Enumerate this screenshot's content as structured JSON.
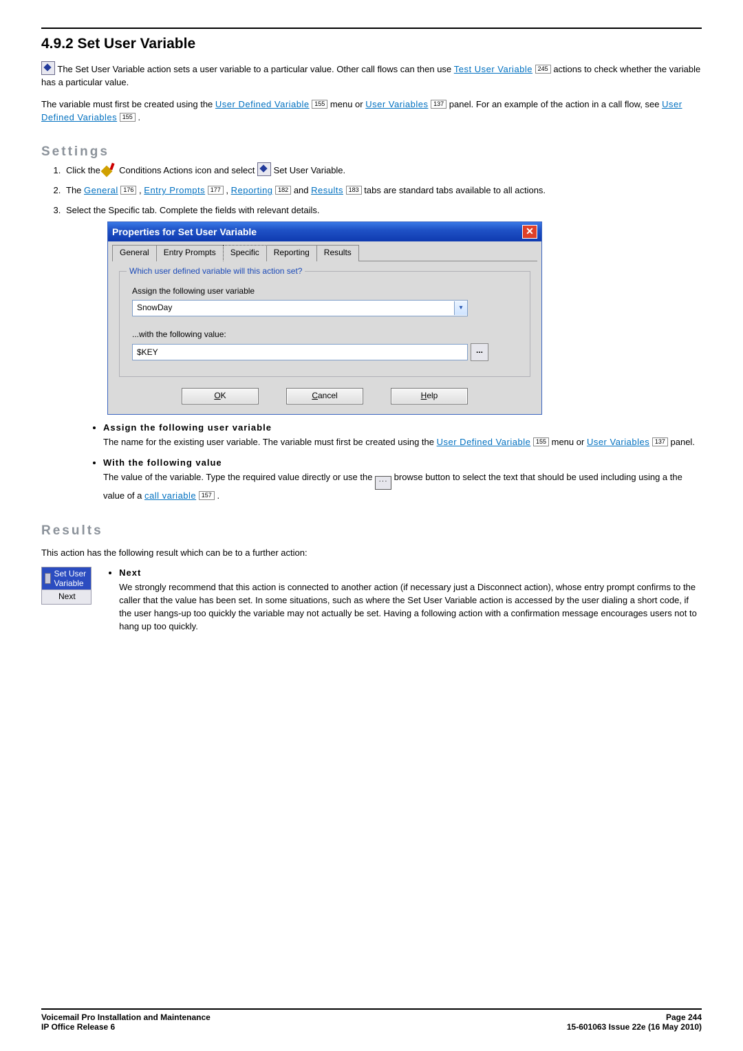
{
  "heading": "4.9.2 Set User Variable",
  "intro": {
    "line1_a": " The Set User Variable action sets a user variable to a particular value. Other call flows can then use ",
    "link_test_user_variable": "Test User Variable",
    "ref_245": "245",
    "line1_b": " actions to check whether the variable has a particular value.",
    "line2_a": "The variable must first be created using the ",
    "link_udv": "User Defined Variable",
    "ref_155": "155",
    "line2_b": " menu or ",
    "link_uv": "User Variables",
    "ref_137": "137",
    "line2_c": " panel. For an example of the action in a call flow, see ",
    "link_udvars2": "User Defined Variables",
    "line2_d": "."
  },
  "settings": {
    "title": "Settings",
    "step1_a": "Click the ",
    "step1_b": " Conditions Actions icon and select ",
    "step1_c": " Set User Variable.",
    "step2_a": "The ",
    "link_general": "General",
    "ref_176": "176",
    "sep": ", ",
    "link_entry": "Entry Prompts",
    "ref_177": "177",
    "link_reporting": "Reporting",
    "ref_182": "182",
    "and": " and ",
    "link_results": "Results",
    "ref_183": "183",
    "step2_b": " tabs are standard tabs available to all actions.",
    "step3": "Select the Specific tab. Complete the fields with relevant details."
  },
  "dialog": {
    "title": "Properties for Set User Variable",
    "tabs": {
      "general": "General",
      "entry": "Entry Prompts",
      "specific": "Specific",
      "reporting": "Reporting",
      "results": "Results"
    },
    "legend": "Which user defined variable will this action set?",
    "label1": "Assign the following user variable",
    "combo_value": "SnowDay",
    "label2": "...with the following value:",
    "text_value": "$KEY",
    "browse": "...",
    "ok": "OK",
    "ok_ul": "O",
    "cancel": "Cancel",
    "cancel_ul": "C",
    "help": "Help",
    "help_ul": "H"
  },
  "opts": {
    "opt1_title": "Assign the following user variable",
    "opt1_body_a": "The name for the existing user variable. The variable must first be created using the ",
    "opt1_link1": "User Defined Variable",
    "opt1_ref155": "155",
    "opt1_body_b": " menu or ",
    "opt1_link2": "User Variables",
    "opt1_ref137": "137",
    "opt1_body_c": " panel.",
    "opt2_title": "With the following value",
    "opt2_body_a": "The value of the variable. Type the required value directly or use the ",
    "opt2_body_b": " browse button to select the text that should be used including using a the value of a ",
    "opt2_link": "call variable",
    "opt2_ref157": "157",
    "opt2_body_c": "."
  },
  "results": {
    "title": "Results",
    "intro": "This action has the following result which can be to a further action:",
    "node_title": "Set User Variable",
    "node_row": "Next",
    "next_title": "Next",
    "next_body": "We strongly recommend that this action is connected to another action (if necessary just a Disconnect action), whose entry prompt confirms to the caller that the value has been set. In some situations, such as where the Set User Variable action is accessed by the user dialing a short code, if the user hangs-up too quickly the variable may not actually be set. Having a following action with a confirmation message encourages users not to hang up too quickly."
  },
  "footer": {
    "left1": "Voicemail Pro Installation and Maintenance",
    "left2": "IP Office Release 6",
    "right1": "Page 244",
    "right2": "15-601063 Issue 22e (16 May 2010)"
  }
}
